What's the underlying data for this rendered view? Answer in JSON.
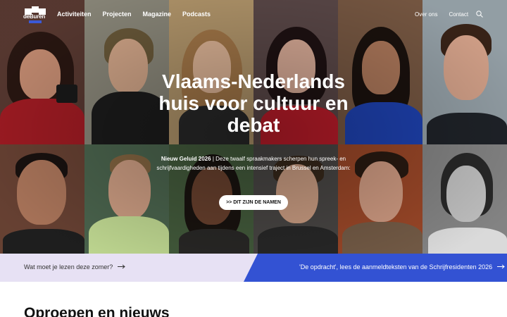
{
  "logo": {
    "text": "deBuren"
  },
  "nav": {
    "main": [
      "Activiteiten",
      "Projecten",
      "Magazine",
      "Podcasts"
    ],
    "secondary": [
      "Over ons",
      "Contact"
    ],
    "search_icon": "search-icon"
  },
  "hero": {
    "headline": "Vlaams-Nederlands huis voor cultuur en debat",
    "intro_bold": "Nieuw Geluid 2026",
    "intro_text": " | Deze twaalf spraakmakers scherpen hun spreek- en schrijfvaardigheden aan tijdens een intensief traject in Brussel en Amsterdam:",
    "cta_label": ">> DIT ZIJN DE NAMEN"
  },
  "banners": {
    "left_label": "Wat moet je lezen deze zomer?",
    "right_label": "'De opdracht', lees de aanmeldteksten van de Schrijfresidenten 2026"
  },
  "section": {
    "title": "Oproepen en nieuws"
  },
  "colors": {
    "accent_blue": "#3352d3",
    "lavender": "#e7e1f4"
  }
}
